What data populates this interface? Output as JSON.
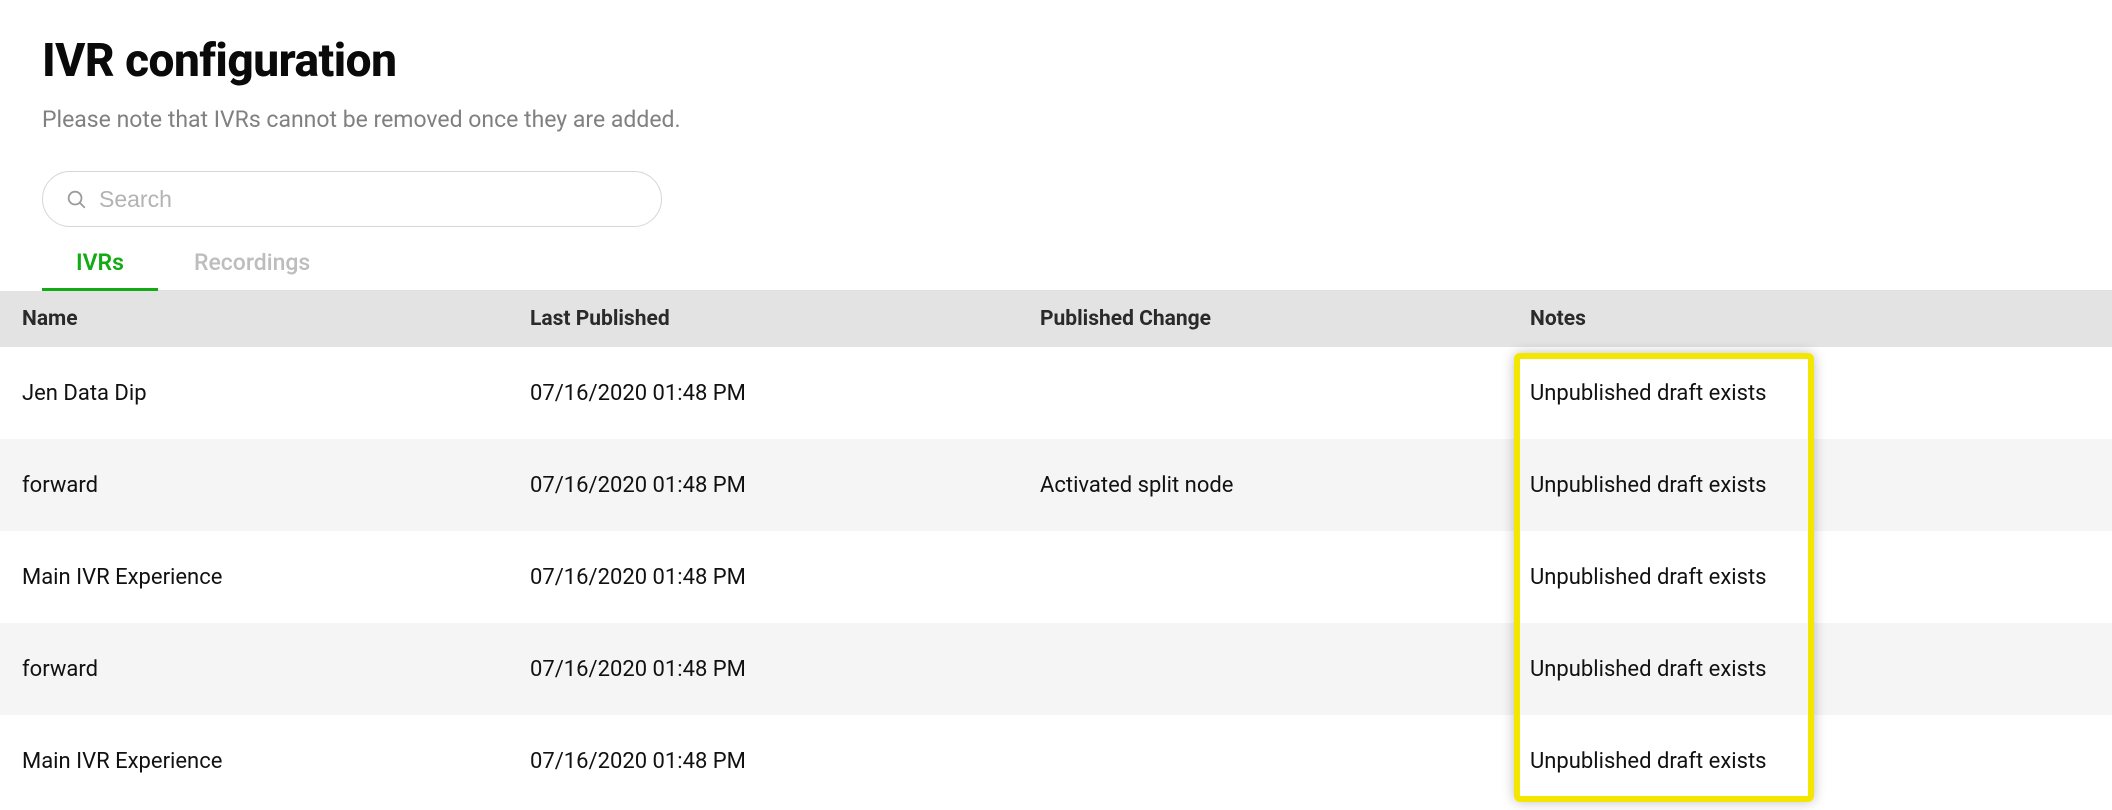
{
  "page": {
    "title": "IVR configuration",
    "subtitle": "Please note that IVRs cannot be removed once they are added."
  },
  "search": {
    "placeholder": "Search",
    "value": ""
  },
  "tabs": {
    "items": [
      {
        "label": "IVRs",
        "active": true
      },
      {
        "label": "Recordings",
        "active": false
      }
    ]
  },
  "table": {
    "headers": {
      "name": "Name",
      "last_published": "Last Published",
      "published_change": "Published Change",
      "notes": "Notes"
    },
    "rows": [
      {
        "name": "Jen Data Dip",
        "last_published": "07/16/2020 01:48 PM",
        "published_change": "",
        "notes": "Unpublished draft exists"
      },
      {
        "name": "forward",
        "last_published": "07/16/2020 01:48 PM",
        "published_change": "Activated split node",
        "notes": "Unpublished draft exists"
      },
      {
        "name": "Main IVR Experience",
        "last_published": "07/16/2020 01:48 PM",
        "published_change": "",
        "notes": "Unpublished draft exists"
      },
      {
        "name": "forward",
        "last_published": "07/16/2020 01:48 PM",
        "published_change": "",
        "notes": "Unpublished draft exists"
      },
      {
        "name": "Main IVR Experience",
        "last_published": "07/16/2020 01:48 PM",
        "published_change": "",
        "notes": "Unpublished draft exists"
      }
    ]
  },
  "highlight": {
    "color": "#f3e600"
  }
}
